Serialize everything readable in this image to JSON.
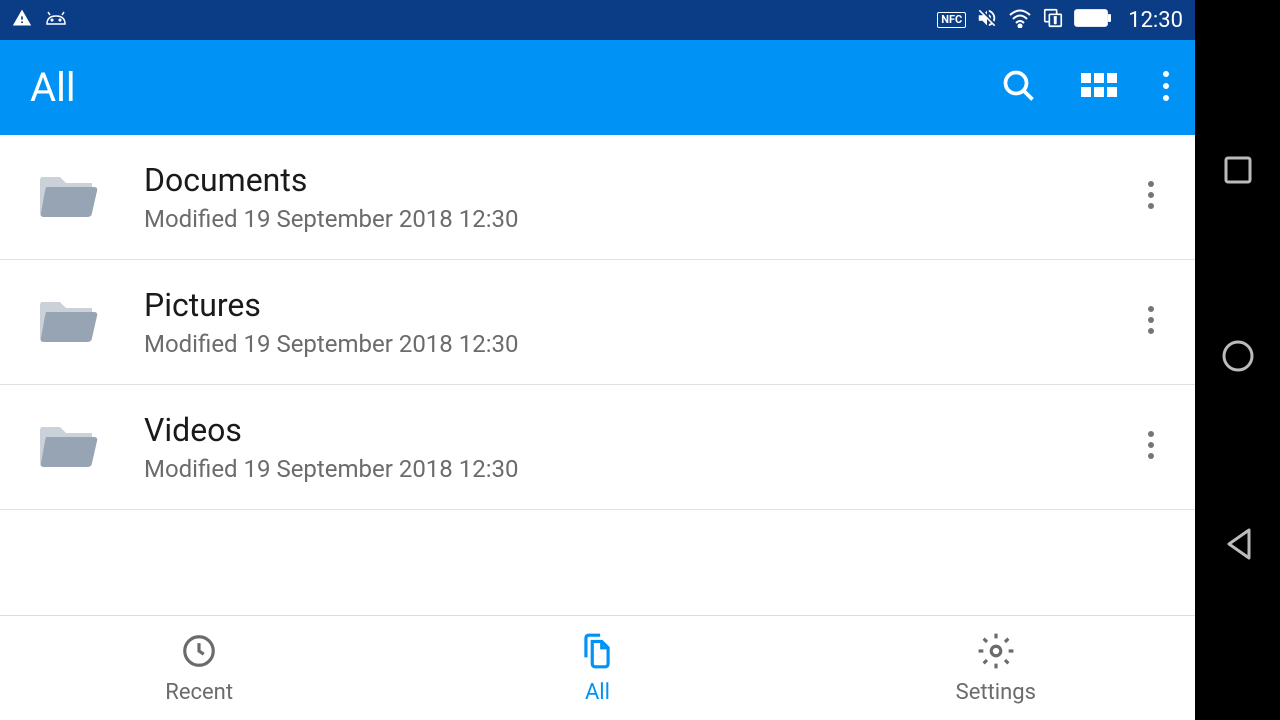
{
  "status": {
    "clock": "12:30",
    "nfc": "NFC"
  },
  "appbar": {
    "title": "All"
  },
  "folders": [
    {
      "name": "Documents",
      "modified": "Modified 19 September 2018 12:30"
    },
    {
      "name": "Pictures",
      "modified": "Modified 19 September 2018 12:30"
    },
    {
      "name": "Videos",
      "modified": "Modified 19 September 2018 12:30"
    }
  ],
  "bottomnav": {
    "recent": "Recent",
    "all": "All",
    "settings": "Settings"
  }
}
